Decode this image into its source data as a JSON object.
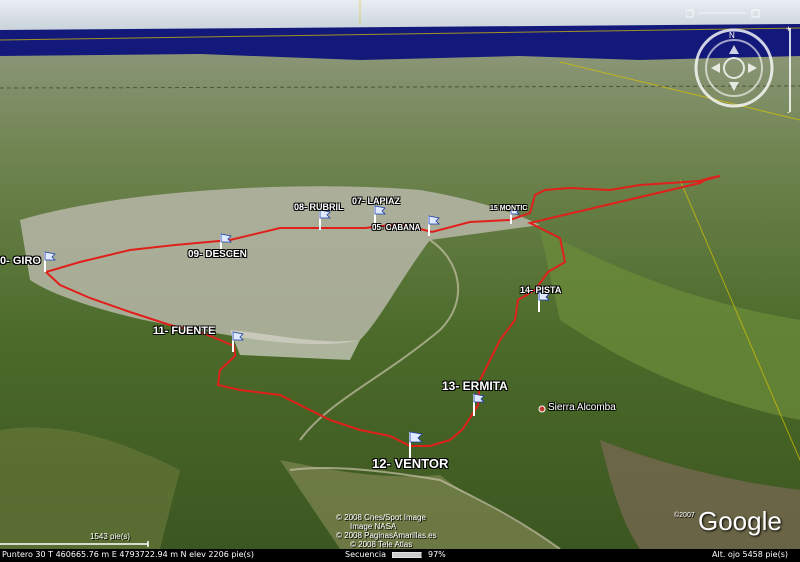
{
  "waypoints": [
    {
      "id": "giro",
      "label": "0- GIRO"
    },
    {
      "id": "descen",
      "label": "09- DESCEN"
    },
    {
      "id": "rubril",
      "label": "08- RUBRIL"
    },
    {
      "id": "lapiaz",
      "label": "07- LAPIAZ"
    },
    {
      "id": "cabana",
      "label": "05- CABANA"
    },
    {
      "id": "montic",
      "label": "15 MONTIC"
    },
    {
      "id": "pista",
      "label": "14- PISTA"
    },
    {
      "id": "fuente",
      "label": "11- FUENTE"
    },
    {
      "id": "ermita",
      "label": "13- ERMITA"
    },
    {
      "id": "ventor",
      "label": "12- VENTOR"
    }
  ],
  "place": {
    "label": "Sierra Alcomba"
  },
  "copyright": [
    "© 2008 Cnes/Spot Image",
    "Image NASA",
    "© 2008 PaginasAmarillas.es",
    "© 2008 Tele Atlas"
  ],
  "logo": {
    "text": "Google",
    "year": "©2007"
  },
  "scale_label": "1543 pie(s)",
  "status": {
    "pointer": "Puntero  30 T     460665.76 m E   4793722.94 m N    elev    2206 pie(s)",
    "stream": "Secuencia",
    "stream_pct": "97%",
    "eye_alt": "Alt. ojo     5458 pie(s)"
  },
  "colors": {
    "route": "#e0201b",
    "sea": "#13197a"
  }
}
